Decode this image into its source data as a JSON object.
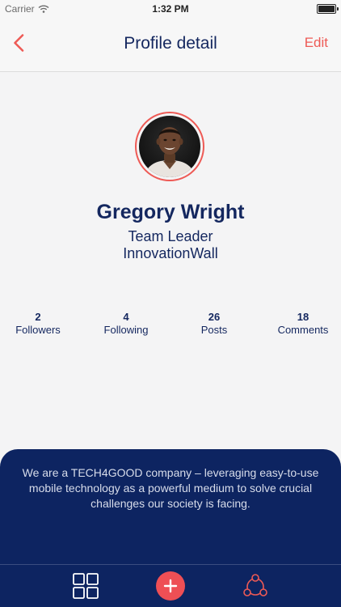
{
  "status_bar": {
    "carrier": "Carrier",
    "time": "1:32 PM"
  },
  "nav": {
    "title": "Profile detail",
    "edit_label": "Edit",
    "back_icon": "chevron-left-icon"
  },
  "profile": {
    "name": "Gregory Wright",
    "role": "Team Leader",
    "company": "InnovationWall"
  },
  "stats": [
    {
      "value": "2",
      "label": "Followers"
    },
    {
      "value": "4",
      "label": "Following"
    },
    {
      "value": "26",
      "label": "Posts"
    },
    {
      "value": "18",
      "label": "Comments"
    }
  ],
  "bio": "We are a TECH4GOOD company – leveraging easy-to-use mobile technology as a powerful medium to solve crucial challenges our society is facing.",
  "tab_bar": {
    "items": [
      "grid-icon",
      "add-icon",
      "share-network-icon"
    ]
  },
  "colors": {
    "accent": "#ee5a55",
    "navy": "#0d2461",
    "background": "#f4f4f5"
  }
}
